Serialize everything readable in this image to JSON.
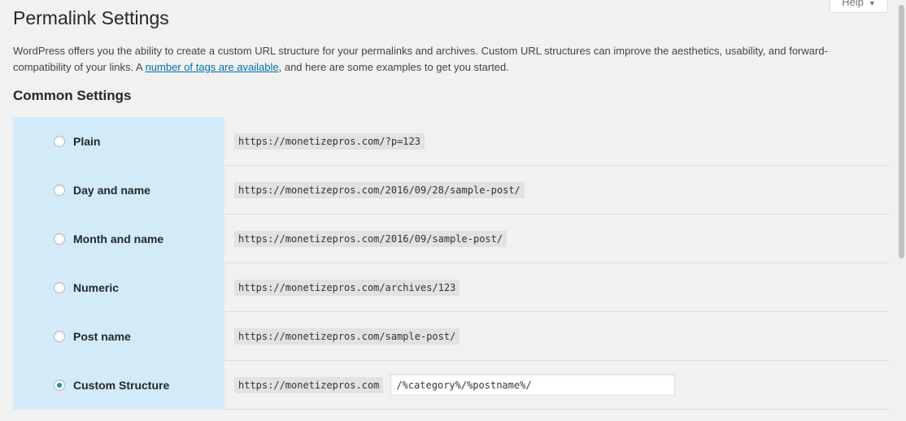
{
  "help_tab": {
    "label": "Help",
    "caret": "▼"
  },
  "page_title": "Permalink Settings",
  "intro": {
    "text_before_link": "WordPress offers you the ability to create a custom URL structure for your permalinks and archives. Custom URL structures can improve the aesthetics, usability, and forward-compatibility of your links. A ",
    "link_text": "number of tags are available",
    "text_after_link": ", and here are some examples to get you started."
  },
  "common_settings": {
    "title": "Common Settings",
    "options": [
      {
        "label": "Plain",
        "example": "https://monetizepros.com/?p=123",
        "checked": false
      },
      {
        "label": "Day and name",
        "example": "https://monetizepros.com/2016/09/28/sample-post/",
        "checked": false
      },
      {
        "label": "Month and name",
        "example": "https://monetizepros.com/2016/09/sample-post/",
        "checked": false
      },
      {
        "label": "Numeric",
        "example": "https://monetizepros.com/archives/123",
        "checked": false
      },
      {
        "label": "Post name",
        "example": "https://monetizepros.com/sample-post/",
        "checked": false
      },
      {
        "label": "Custom Structure",
        "example": "https://monetizepros.com",
        "checked": true,
        "input_value": "/%category%/%postname%/"
      }
    ]
  },
  "colors": {
    "label_cell_bg": "#d3ebf8",
    "link": "#0073aa",
    "radio_checked": "#1e8cbe"
  }
}
